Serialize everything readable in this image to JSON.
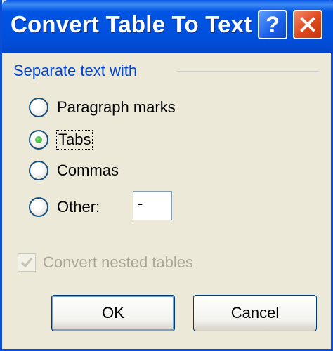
{
  "window": {
    "title": "Convert Table To Text",
    "help_button_glyph": "?",
    "close_button_icon": "close-icon"
  },
  "group": {
    "label": "Separate text with"
  },
  "options": {
    "paragraph": "Paragraph marks",
    "tabs": "Tabs",
    "commas": "Commas",
    "other": "Other:",
    "other_value": "-",
    "selected": "Tabs"
  },
  "nested": {
    "label": "Convert nested tables",
    "checked": true,
    "enabled": false
  },
  "buttons": {
    "ok": "OK",
    "cancel": "Cancel"
  },
  "colors": {
    "titlebar": "#0054e3",
    "dialog_bg": "#ece9d8",
    "group_label": "#0046d5",
    "disabled_text": "#aca899"
  }
}
